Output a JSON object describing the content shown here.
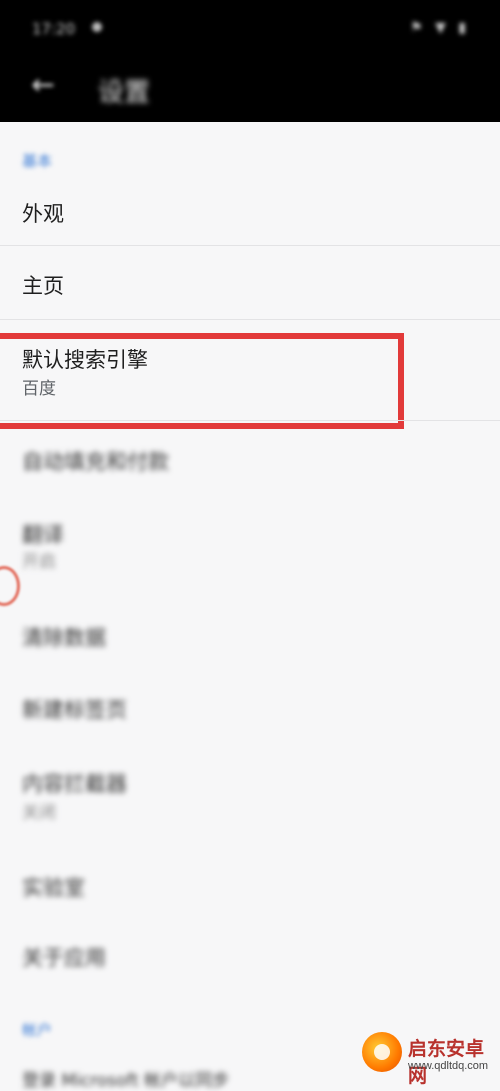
{
  "status_bar": {
    "time": "17:20",
    "icons": "⚑ ▼ ▮"
  },
  "app_bar": {
    "back_glyph": "←",
    "title": "设置"
  },
  "sections": [
    {
      "header": "基本"
    },
    {
      "header": "帐户"
    }
  ],
  "rows": [
    {
      "title": "外观",
      "subtitle": ""
    },
    {
      "title": "主页",
      "subtitle": ""
    },
    {
      "title": "默认搜索引擎",
      "subtitle": "百度"
    },
    {
      "title": "自动填充和付款",
      "subtitle": ""
    },
    {
      "title": "翻译",
      "subtitle": "开启"
    },
    {
      "title": "清除数据",
      "subtitle": ""
    },
    {
      "title": "新建标签页",
      "subtitle": ""
    },
    {
      "title": "内容拦截器",
      "subtitle": "关闭"
    },
    {
      "title": "实验室",
      "subtitle": ""
    },
    {
      "title": "关于应用",
      "subtitle": ""
    },
    {
      "title": "登录 Microsoft 帐户以同步",
      "subtitle": ""
    }
  ],
  "watermark": {
    "name": "启东安卓网",
    "url": "www.qdltdq.com"
  }
}
